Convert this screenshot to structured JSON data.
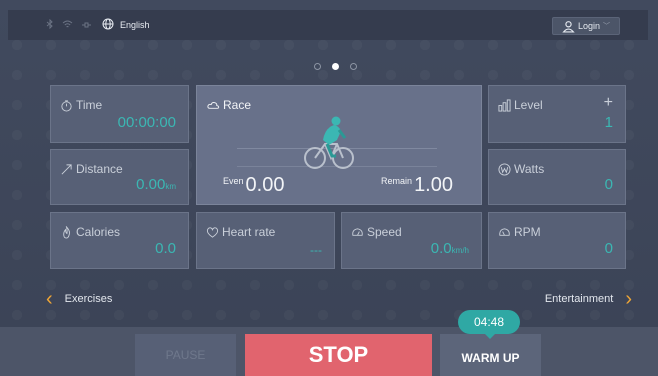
{
  "topbar": {
    "status_icons": [
      "bluetooth-icon",
      "wifi-icon",
      "link-icon"
    ],
    "language_icon": "globe-icon",
    "language": "English",
    "login_label": "Login",
    "login_icon": "user-icon"
  },
  "pagination": {
    "count": 3,
    "active_index": 1
  },
  "tiles": {
    "time": {
      "label": "Time",
      "value": "00:00:00",
      "icon": "stopwatch-icon"
    },
    "distance": {
      "label": "Distance",
      "value": "0.00",
      "unit": "km",
      "icon": "diagonal-arrow-icon"
    },
    "calories": {
      "label": "Calories",
      "value": "0.0",
      "icon": "flame-icon"
    },
    "heart_rate": {
      "label": "Heart rate",
      "value": "---",
      "icon": "heart-icon"
    },
    "speed": {
      "label": "Speed",
      "value": "0.0",
      "unit": "km/h",
      "icon": "speedometer-icon"
    },
    "level": {
      "label": "Level",
      "value": "1",
      "icon": "bars-icon",
      "plus": "+"
    },
    "watts": {
      "label": "Watts",
      "value": "0",
      "icon": "w-circle-icon"
    },
    "rpm": {
      "label": "RPM",
      "value": "0",
      "icon": "gauge-icon"
    }
  },
  "race": {
    "label": "Race",
    "icon": "cloud-icon",
    "even_label": "Even",
    "even_value": "0.00",
    "remain_label": "Remain",
    "remain_value": "1.00"
  },
  "nav": {
    "left_label": "Exercises",
    "right_label": "Entertainment",
    "left_chevron": "‹",
    "right_chevron": "›"
  },
  "controls": {
    "pause_label": "PAUSE",
    "stop_label": "STOP",
    "warmup_label": "WARM UP",
    "timer": "04:48"
  },
  "colors": {
    "accent_teal": "#3bb7b3",
    "stop_red": "#e1646e",
    "chevron_orange": "#f0a636"
  }
}
